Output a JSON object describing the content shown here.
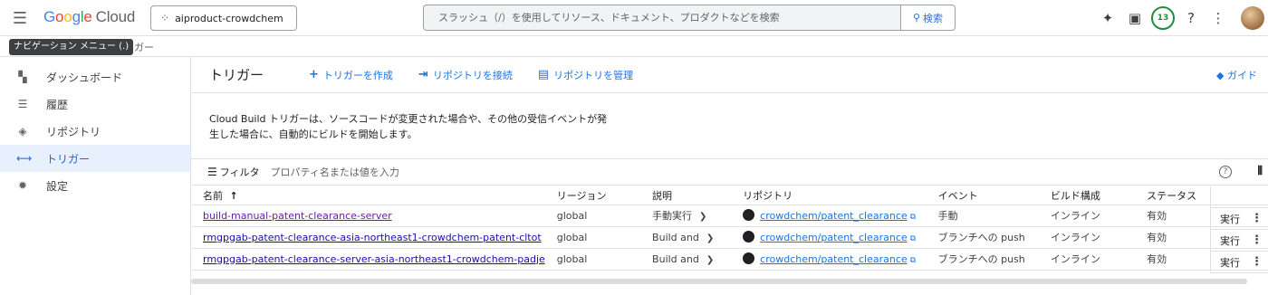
{
  "header": {
    "menu_icon": "hamburger-icon",
    "logo_google": [
      "G",
      "o",
      "o",
      "g",
      "l",
      "e"
    ],
    "logo_cloud": "Cloud",
    "project": "aiproduct-crowdchem",
    "search_placeholder": "スラッシュ（/）を使用してリソース、ドキュメント、プロダクトなどを検索",
    "search_button": "検索",
    "notifications_count": "13"
  },
  "tooltip": "ナビゲーション メニュー (.)",
  "breadcrumb_tail": "ガー",
  "sidebar": {
    "items": [
      {
        "label": "ダッシュボード",
        "icon": "dashboard-icon",
        "glyph": "▚"
      },
      {
        "label": "履歴",
        "icon": "history-list-icon",
        "glyph": "☰"
      },
      {
        "label": "リポジトリ",
        "icon": "repository-icon",
        "glyph": "◈"
      },
      {
        "label": "トリガー",
        "icon": "trigger-icon",
        "glyph": "⟷"
      },
      {
        "label": "設定",
        "icon": "settings-gear-icon",
        "glyph": "✹"
      }
    ],
    "active_index": 3
  },
  "main": {
    "title": "トリガー",
    "actions": [
      {
        "label": "トリガーを作成",
        "icon": "plus-icon",
        "glyph": "+"
      },
      {
        "label": "リポジトリを接続",
        "icon": "connect-icon",
        "glyph": "⇥"
      },
      {
        "label": "リポジトリを管理",
        "icon": "manage-icon",
        "glyph": "▤"
      }
    ],
    "guide": "ガイド",
    "description": "Cloud Build トリガーは、ソースコードが変更された場合や、その他の受信イベントが発生した場合に、自動的にビルドを開始します。",
    "filter_label": "フィルタ",
    "filter_placeholder": "プロパティ名または値を入力"
  },
  "table": {
    "columns": [
      "名前",
      "リージョン",
      "説明",
      "リポジトリ",
      "イベント",
      "ビルド構成",
      "ステータス"
    ],
    "sort_indicator": "↑",
    "rows": [
      {
        "name": "build-manual-patent-clearance-server",
        "region": "global",
        "desc": "手動実行",
        "repo": "crowdchem/patent_clearance",
        "event": "手動",
        "config": "インライン",
        "status": "有効",
        "run": "実行"
      },
      {
        "name": "rmgpgab-patent-clearance-asia-northeast1-crowdchem-patent-cltot",
        "region": "global",
        "desc": "Build and",
        "repo": "crowdchem/patent_clearance",
        "event": "ブランチへの push",
        "config": "インライン",
        "status": "有効",
        "run": "実行"
      },
      {
        "name": "rmgpgab-patent-clearance-server-asia-northeast1-crowdchem-padje",
        "region": "global",
        "desc": "Build and",
        "repo": "crowdchem/patent_clearance",
        "event": "ブランチへの push",
        "config": "インライン",
        "status": "有効",
        "run": "実行"
      }
    ]
  },
  "colors": {
    "accent": "#1a73e8",
    "active_bg": "#e8f0fe",
    "badge": "#1e8e3e"
  }
}
